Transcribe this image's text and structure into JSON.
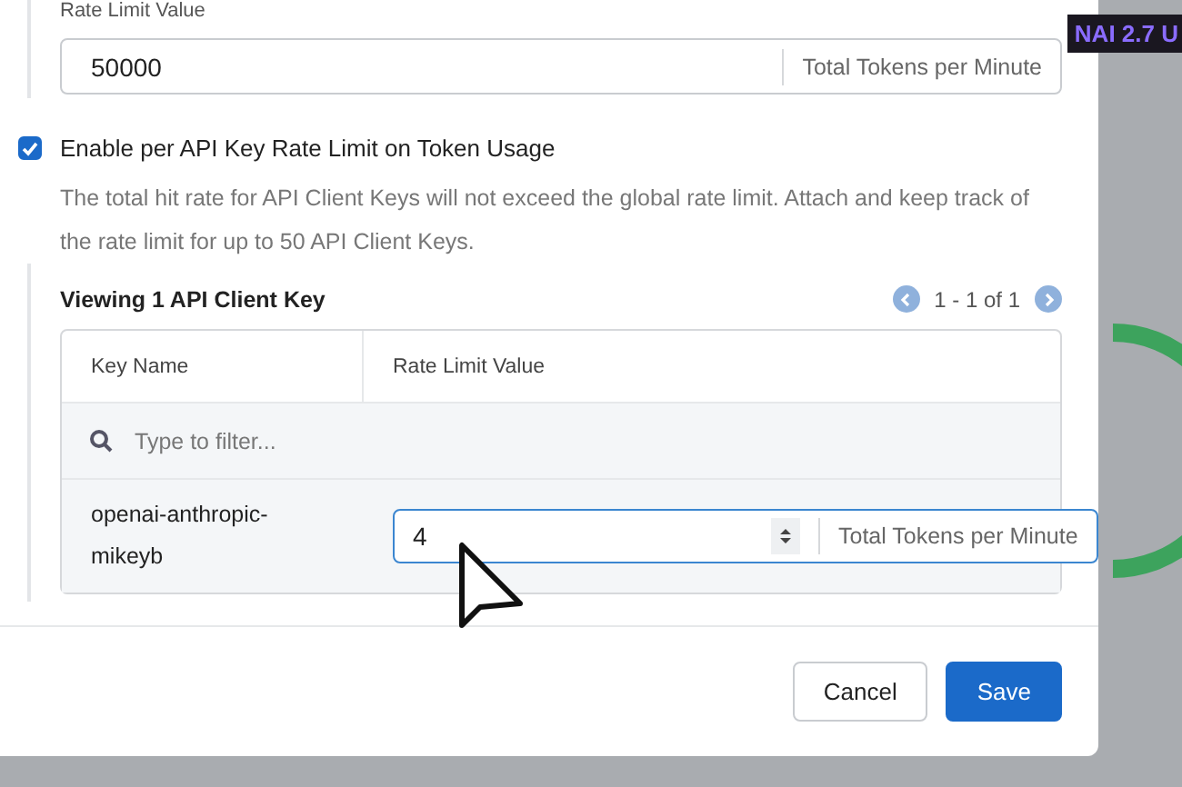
{
  "global_limit": {
    "label": "Rate Limit Value",
    "value": "50000",
    "unit": "Total Tokens per Minute"
  },
  "per_key": {
    "label": "Enable per API Key Rate Limit on Token Usage",
    "checked": true,
    "description": "The total hit rate for API Client Keys will not exceed the global rate limit. Attach and keep track of the rate limit for up to 50 API Client Keys."
  },
  "keys": {
    "title": "Viewing 1 API Client Key",
    "pagination": "1 - 1 of 1",
    "columns": [
      "Key Name",
      "Rate Limit Value"
    ],
    "filter": {
      "placeholder": "Type to filter..."
    },
    "rows": [
      {
        "name": "openai-anthropic-mikeyb",
        "value": "4",
        "unit": "Total Tokens per Minute"
      }
    ]
  },
  "buttons": [
    {
      "label": "Cancel",
      "kind": "secondary"
    },
    {
      "label": "Save",
      "kind": "primary"
    }
  ],
  "badge": "NAI 2.7 U"
}
